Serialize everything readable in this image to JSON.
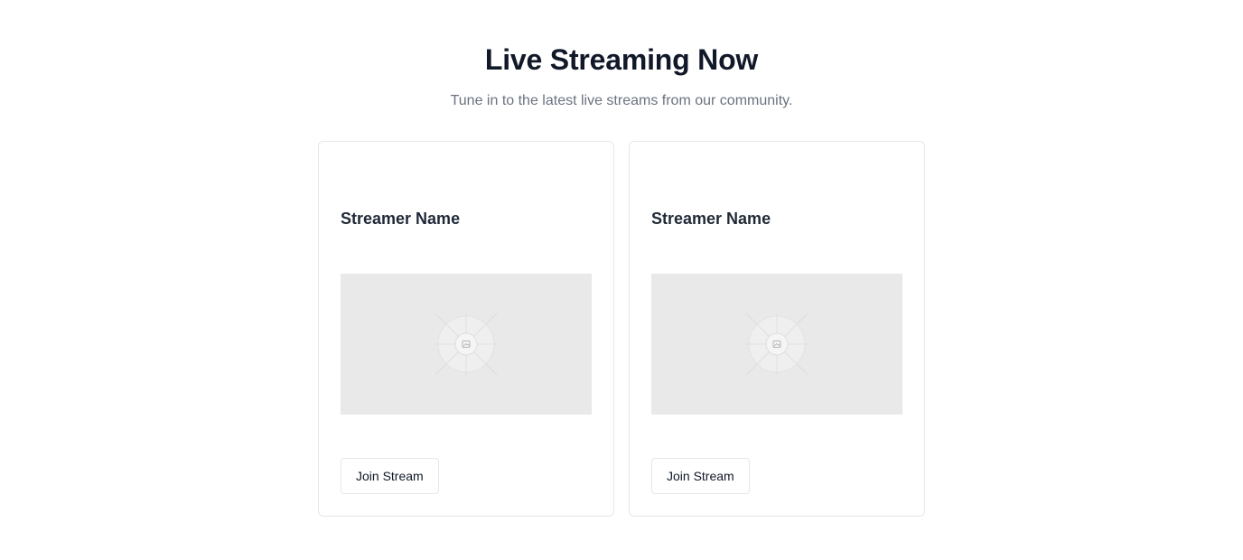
{
  "header": {
    "title": "Live Streaming Now",
    "subtitle": "Tune in to the latest live streams from our community."
  },
  "streams": [
    {
      "name": "Streamer Name",
      "thumbnail_icon": "image-placeholder-icon",
      "join_label": "Join Stream"
    },
    {
      "name": "Streamer Name",
      "thumbnail_icon": "image-placeholder-icon",
      "join_label": "Join Stream"
    }
  ],
  "colors": {
    "title": "#111827",
    "subtitle": "#6b7280",
    "card_border": "#e5e7eb",
    "thumbnail_bg": "#e9e9e9"
  }
}
